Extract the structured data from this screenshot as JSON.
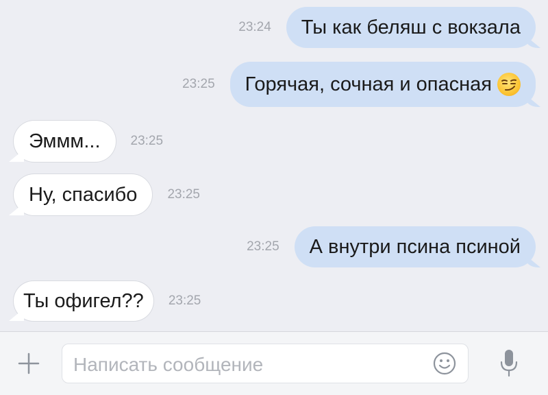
{
  "messages": [
    {
      "direction": "out",
      "text": "Ты как беляш с вокзала",
      "time": "23:24"
    },
    {
      "direction": "out",
      "text": "Горячая, сочная и опасная",
      "time": "23:25",
      "emoji": "smirk-emoji"
    },
    {
      "direction": "in",
      "text": "Эммм...",
      "time": "23:25"
    },
    {
      "direction": "in",
      "text": "Ну, спасибо",
      "time": "23:25"
    },
    {
      "direction": "out",
      "text": "А внутри псина псиной",
      "time": "23:25"
    },
    {
      "direction": "in",
      "text": "Ты офигел??",
      "time": "23:25"
    }
  ],
  "composer": {
    "placeholder": "Написать сообщение",
    "attach_icon": "plus-icon",
    "emoji_icon": "smile-icon",
    "voice_icon": "microphone-icon"
  },
  "colors": {
    "background": "#edeef3",
    "outgoing_bubble": "#cfdff5",
    "incoming_bubble": "#ffffff",
    "timestamp": "#a3a6ad",
    "icon": "#8d939c"
  }
}
